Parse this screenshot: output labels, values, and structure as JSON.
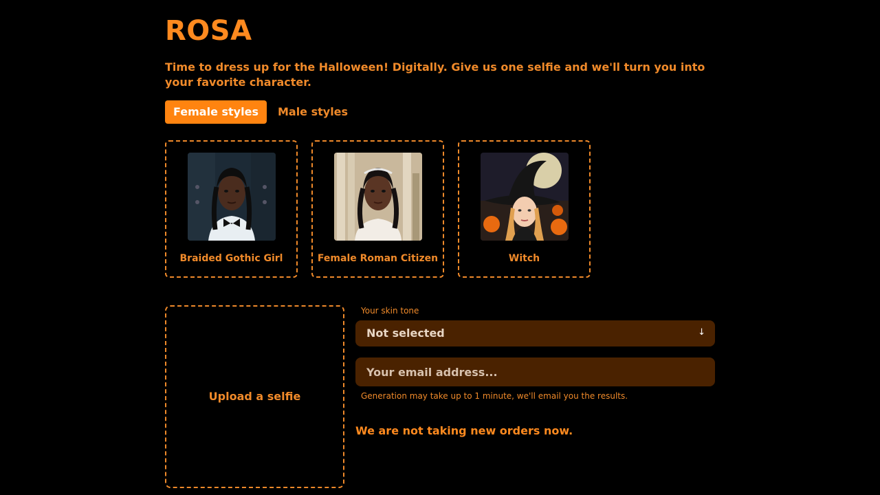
{
  "brand": "ROSA",
  "tagline": "Time to dress up for the Halloween! Digitally. Give us one selfie and we'll turn you into your favorite character.",
  "tabs": [
    {
      "label": "Female styles",
      "active": true
    },
    {
      "label": "Male styles",
      "active": false
    }
  ],
  "styles": [
    {
      "label": "Braided Gothic Girl"
    },
    {
      "label": "Female Roman Citizen"
    },
    {
      "label": "Witch"
    }
  ],
  "upload": {
    "label": "Upload a selfie"
  },
  "skin_tone": {
    "label": "Your skin tone",
    "value": "Not selected",
    "arrow": "↓"
  },
  "email": {
    "placeholder": "Your email address..."
  },
  "hint": "Generation may take up to 1 minute, we'll email you the results.",
  "notice": "We are not taking new orders now.",
  "colors": {
    "accent": "#ff8410",
    "text": "#f08a2a",
    "field_bg": "#4a2200",
    "background": "#000000"
  }
}
